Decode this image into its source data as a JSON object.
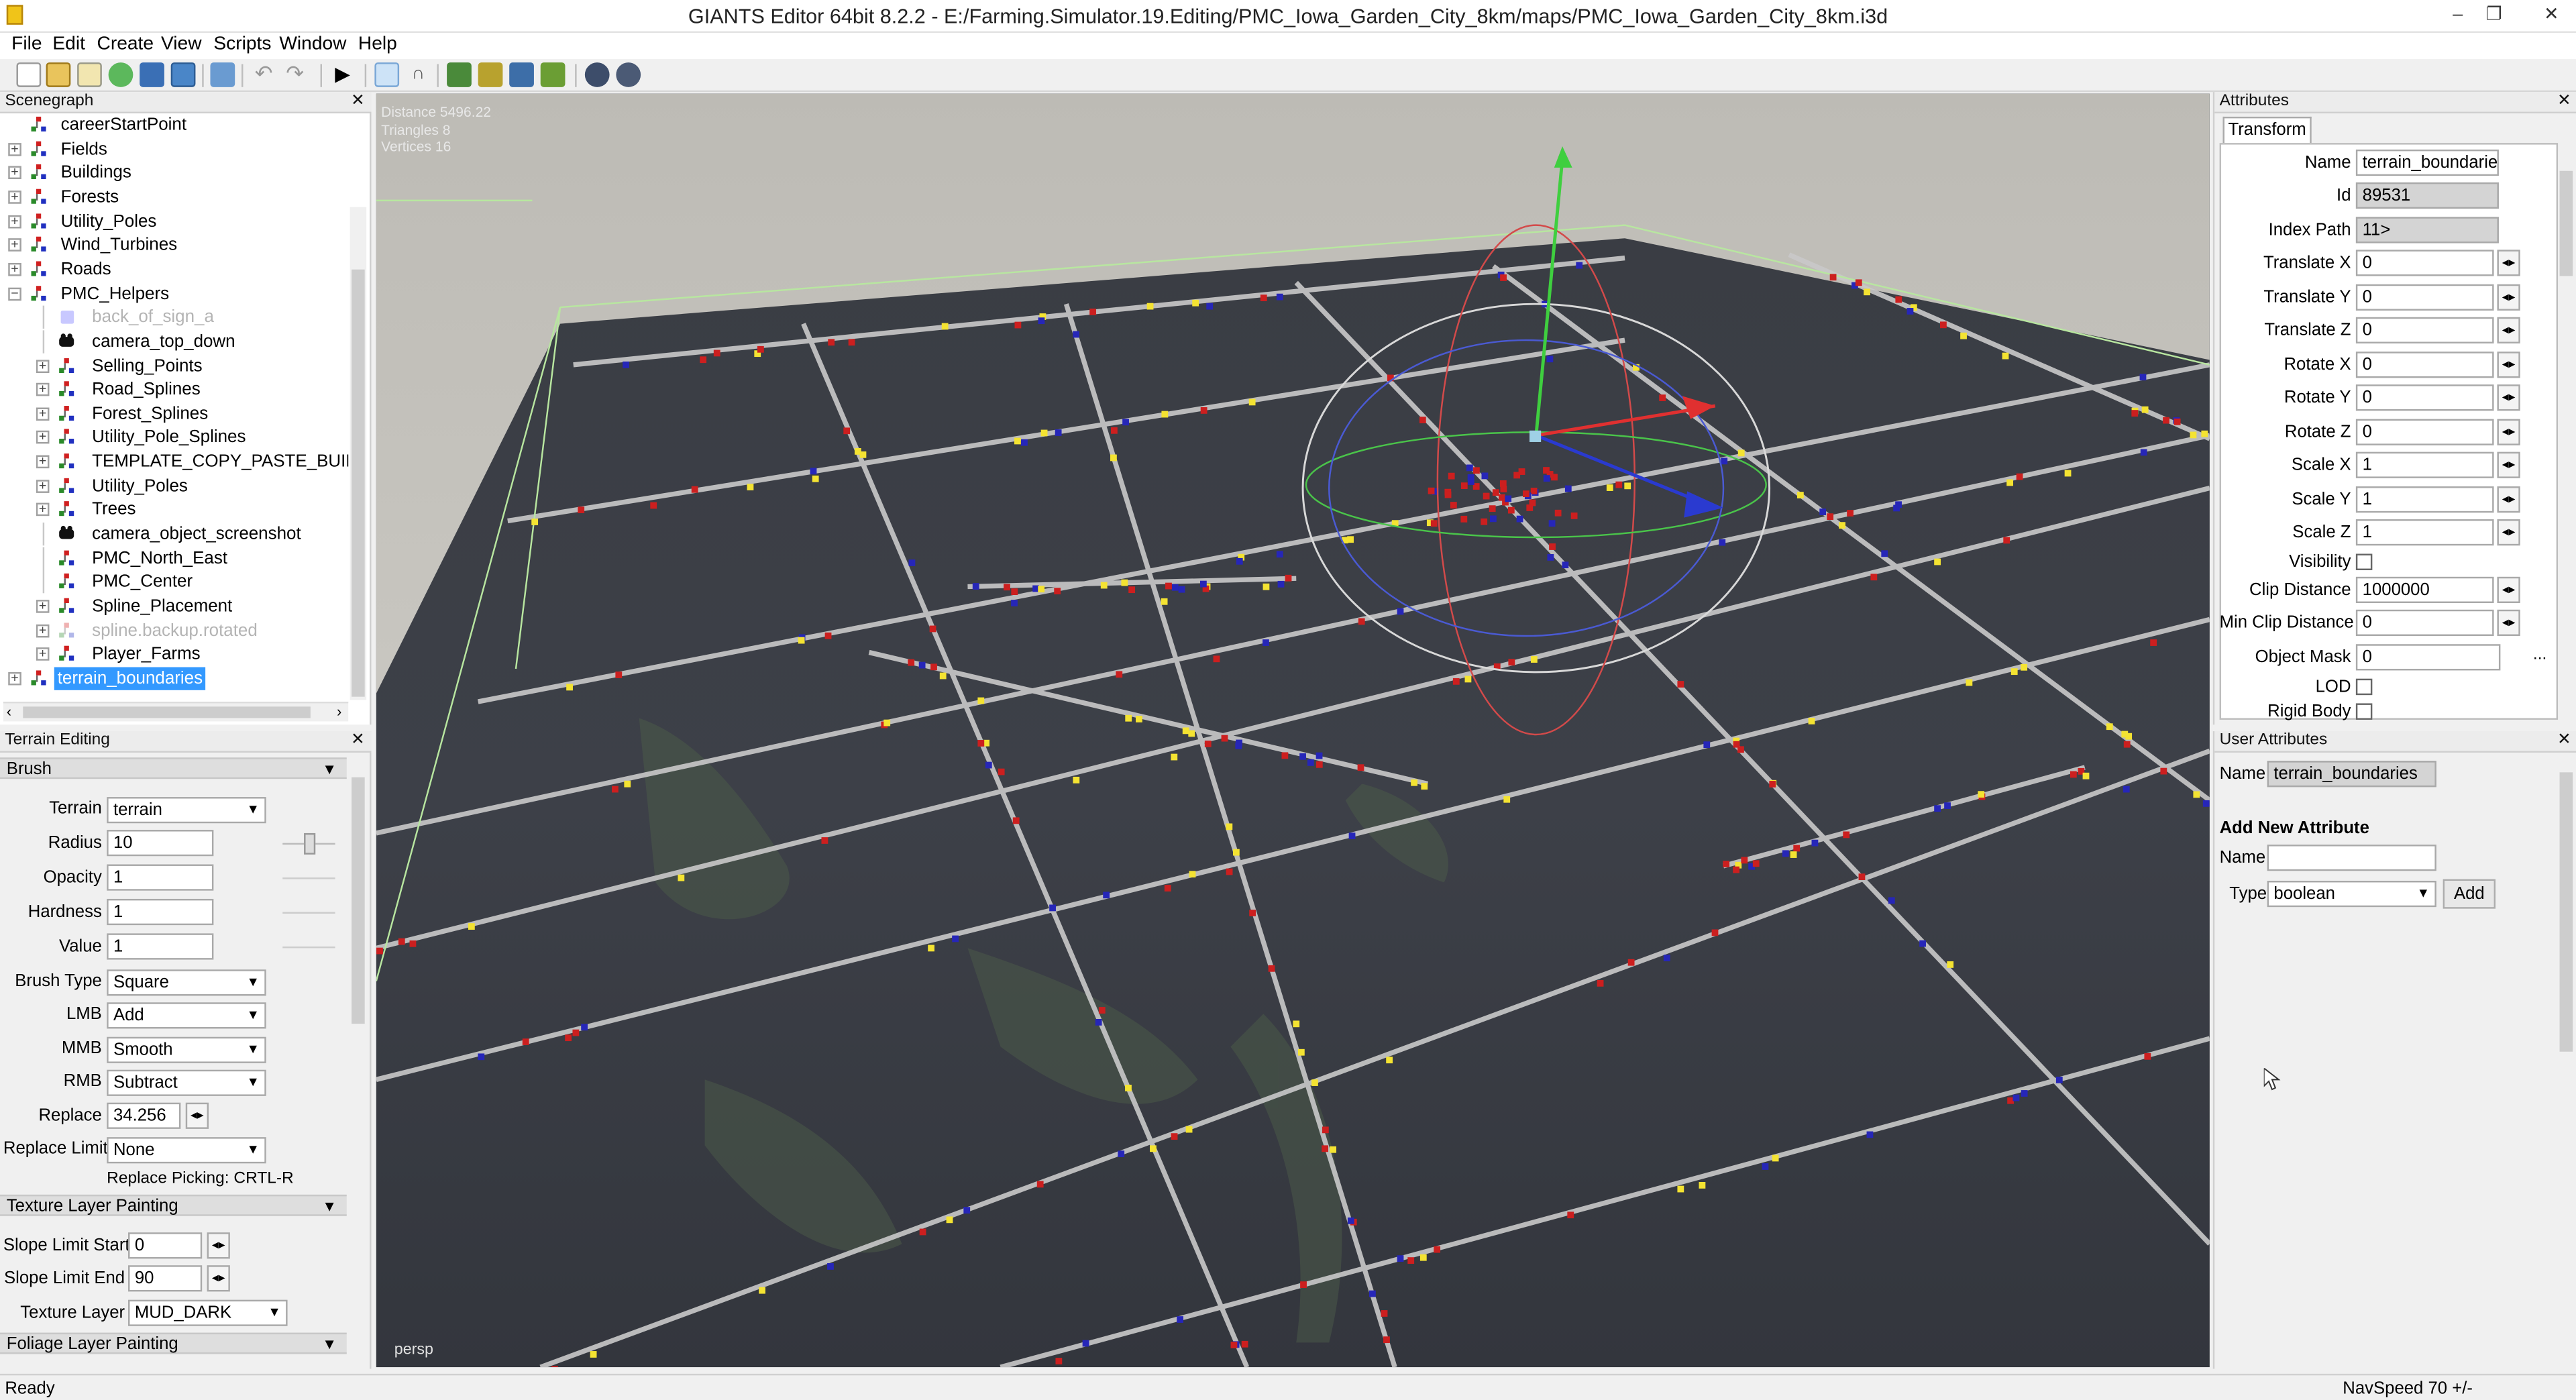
{
  "window": {
    "title": "GIANTS Editor 64bit 8.2.2 - E:/Farming.Simulator.19.Editing/PMC_Iowa_Garden_City_8km/maps/PMC_Iowa_Garden_City_8km.i3d",
    "controls": [
      "–",
      "❐",
      "✕"
    ]
  },
  "menubar": [
    "File",
    "Edit",
    "Create",
    "View",
    "Scripts",
    "Window",
    "Help"
  ],
  "toolbar_icons": [
    "new-file-icon",
    "open-file-icon",
    "edit-file-icon",
    "reload-icon",
    "save-icon",
    "save-as-icon",
    "import-icon",
    "undo-icon",
    "redo-icon",
    "play-icon",
    "select-mode-icon",
    "magnet-icon",
    "terrain-sculpt-icon",
    "terrain-paint-icon",
    "foliage-paint-icon",
    "placement-icon",
    "settings-icon",
    "tools-icon"
  ],
  "scenegraph": {
    "title": "Scenegraph",
    "close": "✕",
    "nodes": [
      {
        "label": "careerStartPoint",
        "depth": 0,
        "exp": false,
        "grey": false,
        "sel": false,
        "icon": "transform"
      },
      {
        "label": "Fields",
        "depth": 0,
        "exp": true,
        "grey": false,
        "sel": false,
        "icon": "transform"
      },
      {
        "label": "Buildings",
        "depth": 0,
        "exp": true,
        "grey": false,
        "sel": false,
        "icon": "transform"
      },
      {
        "label": "Forests",
        "depth": 0,
        "exp": true,
        "grey": false,
        "sel": false,
        "icon": "transform"
      },
      {
        "label": "Utility_Poles",
        "depth": 0,
        "exp": true,
        "grey": false,
        "sel": false,
        "icon": "transform"
      },
      {
        "label": "Wind_Turbines",
        "depth": 0,
        "exp": true,
        "grey": false,
        "sel": false,
        "icon": "transform"
      },
      {
        "label": "Roads",
        "depth": 0,
        "exp": true,
        "grey": false,
        "sel": false,
        "icon": "transform"
      },
      {
        "label": "PMC_Helpers",
        "depth": 0,
        "exp": true,
        "open": true,
        "grey": false,
        "sel": false,
        "icon": "transform"
      },
      {
        "label": "back_of_sign_a",
        "depth": 1,
        "exp": false,
        "grey": true,
        "sel": false,
        "icon": "shape"
      },
      {
        "label": "camera_top_down",
        "depth": 1,
        "exp": false,
        "grey": false,
        "sel": false,
        "icon": "camera"
      },
      {
        "label": "Selling_Points",
        "depth": 1,
        "exp": true,
        "grey": false,
        "sel": false,
        "icon": "transform"
      },
      {
        "label": "Road_Splines",
        "depth": 1,
        "exp": true,
        "grey": false,
        "sel": false,
        "icon": "transform"
      },
      {
        "label": "Forest_Splines",
        "depth": 1,
        "exp": true,
        "grey": false,
        "sel": false,
        "icon": "transform"
      },
      {
        "label": "Utility_Pole_Splines",
        "depth": 1,
        "exp": true,
        "grey": false,
        "sel": false,
        "icon": "transform"
      },
      {
        "label": "TEMPLATE_COPY_PASTE_BUILD",
        "depth": 1,
        "exp": true,
        "grey": false,
        "sel": false,
        "icon": "transform"
      },
      {
        "label": "Utility_Poles",
        "depth": 1,
        "exp": true,
        "grey": false,
        "sel": false,
        "icon": "transform"
      },
      {
        "label": "Trees",
        "depth": 1,
        "exp": true,
        "grey": false,
        "sel": false,
        "icon": "transform"
      },
      {
        "label": "camera_object_screenshot",
        "depth": 1,
        "exp": false,
        "grey": false,
        "sel": false,
        "icon": "camera"
      },
      {
        "label": "PMC_North_East",
        "depth": 1,
        "exp": false,
        "grey": false,
        "sel": false,
        "icon": "transform"
      },
      {
        "label": "PMC_Center",
        "depth": 1,
        "exp": false,
        "grey": false,
        "sel": false,
        "icon": "transform"
      },
      {
        "label": "Spline_Placement",
        "depth": 1,
        "exp": true,
        "grey": false,
        "sel": false,
        "icon": "transform"
      },
      {
        "label": "spline.backup.rotated",
        "depth": 1,
        "exp": true,
        "grey": true,
        "sel": false,
        "icon": "transform"
      },
      {
        "label": "Player_Farms",
        "depth": 1,
        "exp": true,
        "grey": false,
        "sel": false,
        "icon": "transform"
      },
      {
        "label": "terrain_boundaries",
        "depth": 0,
        "exp": true,
        "grey": false,
        "sel": true,
        "icon": "transform"
      }
    ]
  },
  "terrain_editing": {
    "title": "Terrain Editing",
    "close": "✕",
    "brush_section": "Brush",
    "terrain_label": "Terrain",
    "terrain_value": "terrain",
    "radius_label": "Radius",
    "radius_value": "10",
    "opacity_label": "Opacity",
    "opacity_value": "1",
    "hardness_label": "Hardness",
    "hardness_value": "1",
    "value_label": "Value",
    "value_value": "1",
    "brush_type_label": "Brush Type",
    "brush_type_value": "Square",
    "lmb_label": "LMB",
    "lmb_value": "Add",
    "mmb_label": "MMB",
    "mmb_value": "Smooth",
    "rmb_label": "RMB",
    "rmb_value": "Subtract",
    "replace_label": "Replace",
    "replace_value": "34.256",
    "replace_limit_label": "Replace Limit",
    "replace_limit_value": "None",
    "replace_picking": "Replace Picking: CRTL-R",
    "texture_section": "Texture Layer Painting",
    "slope_start_label": "Slope Limit Start",
    "slope_start_value": "0",
    "slope_end_label": "Slope Limit End",
    "slope_end_value": "90",
    "texture_layer_label": "Texture Layer",
    "texture_layer_value": "MUD_DARK",
    "foliage_section": "Foliage Layer Painting"
  },
  "viewport": {
    "stats": [
      "Distance 5496.22",
      "Triangles 8",
      "Vertices 16"
    ],
    "camera": "persp"
  },
  "attributes": {
    "title": "Attributes",
    "close": "✕",
    "tab": "Transform",
    "name_label": "Name",
    "name_value": "terrain_boundaries",
    "id_label": "Id",
    "id_value": "89531",
    "index_label": "Index Path",
    "index_value": "11>",
    "tx_label": "Translate X",
    "tx_value": "0",
    "ty_label": "Translate Y",
    "ty_value": "0",
    "tz_label": "Translate Z",
    "tz_value": "0",
    "rx_label": "Rotate X",
    "rx_value": "0",
    "ry_label": "Rotate Y",
    "ry_value": "0",
    "rz_label": "Rotate Z",
    "rz_value": "0",
    "sx_label": "Scale X",
    "sx_value": "1",
    "sy_label": "Scale Y",
    "sy_value": "1",
    "sz_label": "Scale Z",
    "sz_value": "1",
    "visibility_label": "Visibility",
    "clip_label": "Clip Distance",
    "clip_value": "1000000",
    "minclip_label": "Min Clip Distance",
    "minclip_value": "0",
    "mask_label": "Object Mask",
    "mask_value": "0",
    "mask_btn": "...",
    "lod_label": "LOD",
    "rigid_label": "Rigid Body"
  },
  "user_attributes": {
    "title": "User Attributes",
    "close": "✕",
    "name_label": "Name",
    "name_value": "terrain_boundaries",
    "add_heading": "Add New Attribute",
    "new_name_label": "Name",
    "new_name_value": "",
    "type_label": "Type",
    "type_value": "boolean",
    "add_button": "Add"
  },
  "statusbar": {
    "left": "Ready",
    "right": "NavSpeed 70 +/-"
  },
  "colors": {
    "selection": "#3399ff",
    "terrain": "#3b3e45",
    "road": "#c9c9c9",
    "marker_red": "#cc1f1f",
    "marker_blue": "#2626b8",
    "marker_yellow": "#f4e332"
  }
}
